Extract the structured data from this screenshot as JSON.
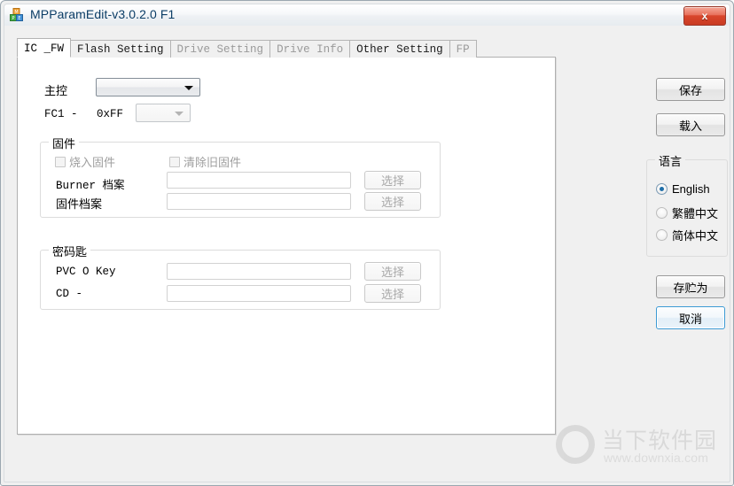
{
  "window": {
    "title": "MPParamEdit-v3.0.2.0 F1",
    "close_label": "x",
    "icon": "app-blocks-icon"
  },
  "tabs": [
    {
      "label": "IC _FW",
      "state": "active"
    },
    {
      "label": "Flash Setting",
      "state": "enabled"
    },
    {
      "label": "Drive Setting",
      "state": "disabled"
    },
    {
      "label": "Drive Info",
      "state": "disabled"
    },
    {
      "label": "Other Setting",
      "state": "enabled"
    },
    {
      "label": "FP",
      "state": "disabled"
    }
  ],
  "main": {
    "controller": {
      "label": "主控",
      "combo_value": ""
    },
    "fc_row": {
      "label": "FC1 -",
      "value": "0xFF",
      "combo_value": ""
    },
    "firmware_group": {
      "legend": "固件",
      "checkbox_burn": "烧入固件",
      "checkbox_clear": "清除旧固件",
      "rows": [
        {
          "label": "Burner 档案",
          "value": "",
          "button": "选择"
        },
        {
          "label": "固件档案",
          "value": "",
          "button": "选择"
        }
      ]
    },
    "key_group": {
      "legend": "密码匙",
      "rows": [
        {
          "label": "PVC O Key",
          "value": "",
          "button": "选择"
        },
        {
          "label": "CD -",
          "value": "",
          "button": "选择"
        }
      ]
    }
  },
  "sidebar": {
    "save_label": "保存",
    "load_label": "载入",
    "language_group": {
      "legend": "语言",
      "options": [
        {
          "label": "English",
          "checked": true
        },
        {
          "label": "繁體中文",
          "checked": false
        },
        {
          "label": "简体中文",
          "checked": false
        }
      ]
    },
    "save_as_label": "存贮为",
    "cancel_label": "取消"
  },
  "watermark": {
    "cn": "当下软件园",
    "url": "www.downxia.com"
  }
}
